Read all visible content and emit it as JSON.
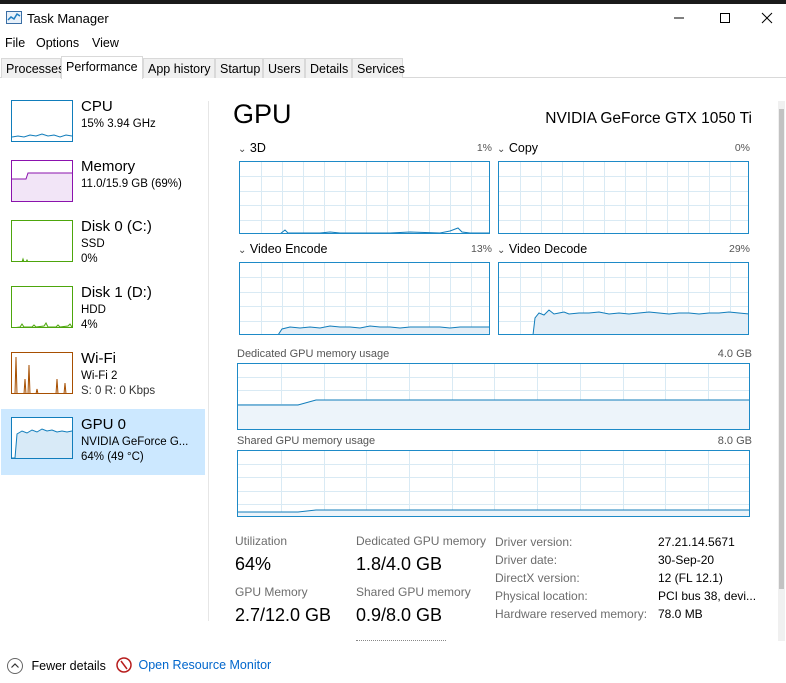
{
  "window": {
    "title": "Task Manager"
  },
  "menu": [
    "File",
    "Options",
    "View"
  ],
  "tabs": [
    "Processes",
    "Performance",
    "App history",
    "Startup",
    "Users",
    "Details",
    "Services"
  ],
  "sidebar": [
    {
      "name": "CPU",
      "line1": "15%  3.94 GHz",
      "line2": "",
      "color": "#117dbb"
    },
    {
      "name": "Memory",
      "line1": "11.0/15.9 GB (69%)",
      "line2": "",
      "color": "#8b12ae"
    },
    {
      "name": "Disk 0 (C:)",
      "line1": "SSD",
      "line2": "0%",
      "color": "#4da60c"
    },
    {
      "name": "Disk 1 (D:)",
      "line1": "HDD",
      "line2": "4%",
      "color": "#4da60c"
    },
    {
      "name": "Wi-Fi",
      "line1": "Wi-Fi 2",
      "line2": "S: 0  R: 0 Kbps",
      "color": "#a74f01"
    },
    {
      "name": "GPU 0",
      "line1": "NVIDIA GeForce G...",
      "line2": "64%  (49 °C)",
      "color": "#117dbb"
    }
  ],
  "main": {
    "title": "GPU",
    "model": "NVIDIA GeForce GTX 1050 Ti",
    "engines": [
      {
        "label": "3D",
        "pct": "1%"
      },
      {
        "label": "Copy",
        "pct": "0%"
      },
      {
        "label": "Video Encode",
        "pct": "13%"
      },
      {
        "label": "Video Decode",
        "pct": "29%"
      }
    ],
    "dedicated": {
      "label": "Dedicated GPU memory usage",
      "max": "4.0 GB"
    },
    "shared": {
      "label": "Shared GPU memory usage",
      "max": "8.0 GB"
    },
    "stats": {
      "utilization_label": "Utilization",
      "utilization_value": "64%",
      "dedicated_label": "Dedicated GPU memory",
      "dedicated_value": "1.8/4.0 GB",
      "gpumem_label": "GPU Memory",
      "gpumem_value": "2.7/12.0 GB",
      "shared_label": "Shared GPU memory",
      "shared_value": "0.9/8.0 GB"
    },
    "info": [
      {
        "label": "Driver version:",
        "value": "27.21.14.5671"
      },
      {
        "label": "Driver date:",
        "value": "30-Sep-20"
      },
      {
        "label": "DirectX version:",
        "value": "12 (FL 12.1)"
      },
      {
        "label": "Physical location:",
        "value": "PCI bus 38, devi..."
      },
      {
        "label": "Hardware reserved memory:",
        "value": "78.0 MB"
      }
    ]
  },
  "footer": {
    "fewer": "Fewer details",
    "monitor": "Open Resource Monitor"
  },
  "colors": {
    "accent": "#117dbb",
    "selected": "#cce8ff",
    "link": "#0066cc",
    "graph_border": "#1e8ac7"
  }
}
